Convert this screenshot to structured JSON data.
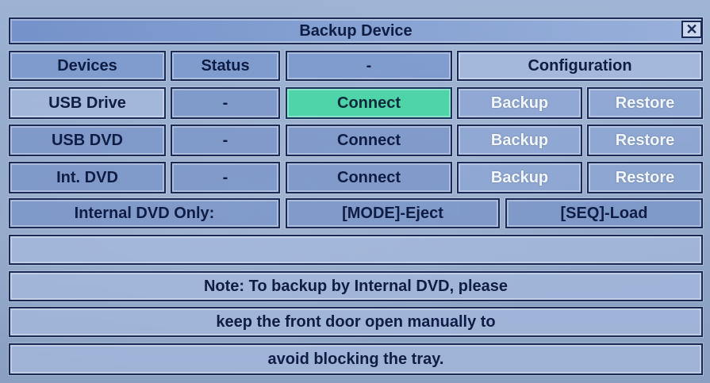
{
  "window": {
    "title": "Backup Device",
    "close_glyph": "✕",
    "close_icon": "close-icon"
  },
  "header": {
    "devices": "Devices",
    "status": "Status",
    "dash": "-",
    "configuration": "Configuration"
  },
  "rows": [
    {
      "device": "USB Drive",
      "status": "-",
      "connect": "Connect",
      "backup": "Backup",
      "restore": "Restore",
      "connect_selected": true
    },
    {
      "device": "USB DVD",
      "status": "-",
      "connect": "Connect",
      "backup": "Backup",
      "restore": "Restore",
      "connect_selected": false
    },
    {
      "device": "Int. DVD",
      "status": "-",
      "connect": "Connect",
      "backup": "Backup",
      "restore": "Restore",
      "connect_selected": false
    }
  ],
  "internal_dvd": {
    "label": "Internal DVD Only:",
    "eject": "[MODE]-Eject",
    "load": "[SEQ]-Load"
  },
  "message": "",
  "notes": [
    "Note: To backup by Internal DVD, please",
    "keep the front door open manually to",
    "avoid blocking the tray."
  ],
  "colors": {
    "selected": "#4fd3a8",
    "border": "#1a2a55",
    "disabled_text": "#f2f6ff"
  }
}
